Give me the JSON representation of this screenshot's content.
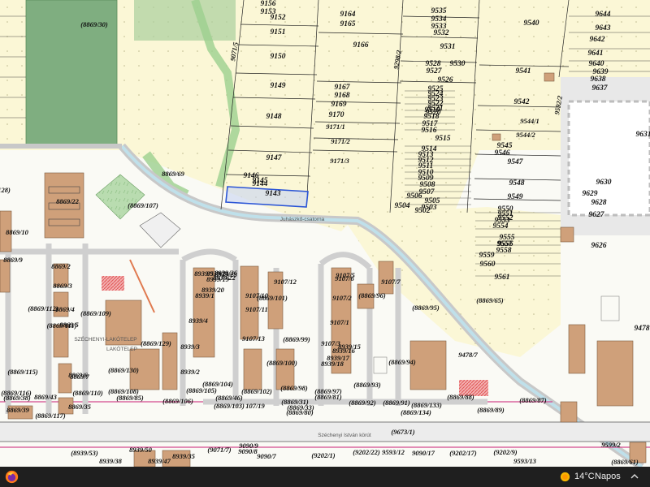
{
  "map": {
    "parcels": [
      "9156",
      "9153",
      "9152",
      "9164",
      "9165",
      "9151",
      "9166",
      "9150",
      "9149",
      "9148",
      "9147",
      "9146",
      "9145",
      "9144",
      "9143",
      "9167",
      "9168",
      "9169",
      "9170",
      "9171/1",
      "9171/2",
      "9171/3",
      "9071/5",
      "9298/2",
      "9535",
      "9534",
      "9533",
      "9532",
      "9531",
      "9530",
      "9528",
      "9527",
      "9526",
      "9525",
      "9524",
      "9523",
      "9522",
      "9521",
      "9520",
      "9519",
      "9518",
      "9517",
      "9516",
      "9515",
      "9514",
      "9513",
      "9512",
      "9511",
      "9510",
      "9509",
      "9508",
      "9507",
      "9506",
      "9505",
      "9504",
      "9503",
      "9502",
      "9540",
      "9541",
      "9542",
      "9544/1",
      "9544/2",
      "9545",
      "9546",
      "9547",
      "9548",
      "9549",
      "9550",
      "9551",
      "9552",
      "9553",
      "9554",
      "9555",
      "9556",
      "9557",
      "9558",
      "9559",
      "9560",
      "9561",
      "9592/2",
      "9644",
      "9643",
      "9642",
      "9641",
      "9640",
      "9639",
      "9638",
      "9637",
      "9631",
      "9630",
      "9629",
      "9628",
      "9627",
      "9626",
      "9478/7",
      "(8869/30)",
      "8869/69",
      "8869/22",
      "(8869/107)",
      "128)",
      "8869/10",
      "8869/9",
      "8869/2",
      "8869/3",
      "8869/4",
      "8869/5",
      "8869/6",
      "8869/7",
      "(8869/112)",
      "(8869/111)",
      "(8869/109)",
      "(8869/115)",
      "(8869/116)",
      "(8869/38)",
      "8869/39",
      "(8869/117)",
      "8869/43",
      "8869/35",
      "8939/1",
      "8939/2",
      "8939/3",
      "8939/4",
      "8939/5",
      "9107/12",
      "9107/10",
      "9107/11",
      "9107/13",
      "9107/1",
      "9107/2",
      "9107/3",
      "9107/5",
      "9107/6",
      "9107/7",
      "(8869/101)",
      "(8869/96)",
      "(8869/95)",
      "(8869/99)",
      "(8869/100)",
      "(8869/93)",
      "(8869/94)",
      "(8869/98)",
      "(8869/97)",
      "(8869/102)",
      "(8869/104)",
      "(8869/105)",
      "(8869/106)",
      "(8869/108)",
      "(8869/110)",
      "(8869/85)",
      "(8869/81)",
      "(8869/80)",
      "(8869/92)",
      "(8869/91)",
      "(8869/133)",
      "(8869/134)",
      "(8869/88)",
      "(8869/89)",
      "(8869/87)",
      "(8869/65)",
      "(8869/129)",
      "(8869/130)",
      "8939/19",
      "8939/20",
      "8939/21",
      "8939/22",
      "8939/23",
      "8939/26",
      "8939/18",
      "8939/17",
      "8939/16",
      "8939/15",
      "(8869/46)",
      "(8869/103)",
      "(8869/31)",
      "(8869/33)",
      "(9673/1)",
      "(8939/53)",
      "8939/50",
      "8939/38",
      "8939/47",
      "8939/35",
      "(9071/7)",
      "9090/9",
      "9090/8",
      "9090/7",
      "(9202/1)",
      "(9202/22)",
      "9593/12",
      "9090/17",
      "(9202/17)",
      "(9202/9)",
      "9593/13",
      "9599/2",
      "(8869/61)",
      "107/19",
      "9478"
    ],
    "street_labels": [
      "Juhászkő-csatorna",
      "Széchenyi István körút",
      "SZÉCHENYI-LAKÓTELEP",
      "LAKÓTELEP"
    ],
    "highlighted_parcel": "9143",
    "colors": {
      "agri": "#fbf7d6",
      "green": "#7fae80",
      "road": "#dcdcdc",
      "highlight": "#2b55d6",
      "building": "#cfa07a",
      "hatch": "#e05555"
    }
  },
  "taskbar": {
    "temperature": "14°C",
    "condition": "Napos",
    "icons": [
      "firefox-icon",
      "sun-weather-icon",
      "chevron-up-icon"
    ]
  }
}
